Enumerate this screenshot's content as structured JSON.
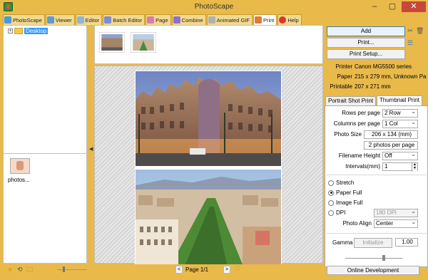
{
  "window": {
    "title": "PhotoScape",
    "min": "–",
    "max": "▢",
    "close": "✕"
  },
  "tabs": [
    {
      "label": "PhotoScape",
      "icon": "photoscape-icon",
      "color": "#4a9ad8"
    },
    {
      "label": "Viewer",
      "icon": "viewer-icon",
      "color": "#5b9bd5"
    },
    {
      "label": "Editor",
      "icon": "editor-icon",
      "color": "#8fb4d9"
    },
    {
      "label": "Batch Editor",
      "icon": "batch-editor-icon",
      "color": "#7b8bd4"
    },
    {
      "label": "Page",
      "icon": "page-icon",
      "color": "#d97ab2"
    },
    {
      "label": "Combine",
      "icon": "combine-icon",
      "color": "#8c6fd1"
    },
    {
      "label": "Animated GIF",
      "icon": "animated-gif-icon",
      "color": "#b0b0b0"
    },
    {
      "label": "Print",
      "icon": "print-icon",
      "color": "#e07a2e",
      "active": true
    },
    {
      "label": "Help",
      "icon": "help-icon",
      "color": "#d33"
    }
  ],
  "tree": {
    "expander": "+",
    "root": "Desktop"
  },
  "left": {
    "file_label": "photos...",
    "icons": [
      "★",
      "⟲",
      "🗀"
    ]
  },
  "preview": {
    "page_label": "Page 1/1",
    "prev": "<",
    "next": ">",
    "fit": "⛶"
  },
  "right": {
    "add": "Add",
    "print": "Print...",
    "print_setup": "Print Setup...",
    "printer_label": "Printer",
    "printer_value": "Canon MG5500 series",
    "paper_label": "Paper",
    "paper_value": "215 x 279 mm, Unknown Pa",
    "printable_label": "Printable",
    "printable_value": "207 x 271 mm",
    "tab_portrait": "Portrait Shot Print",
    "tab_thumbnail": "Thumbnail Print",
    "rows_label": "Rows per page",
    "rows_value": "2 Row",
    "cols_label": "Columns per page",
    "cols_value": "1 Col",
    "photo_size_label": "Photo Size",
    "photo_size_value": "206 x 134 (mm)",
    "photos_per_page": "2 photos per page",
    "filename_height_label": "Filename Height",
    "filename_height_value": "Off",
    "intervals_label": "Intervals(mm)",
    "intervals_value": "1",
    "stretch": "Stretch",
    "paper_full": "Paper Full",
    "image_full": "Image Full",
    "dpi": "DPI",
    "dpi_value": "180 DPI",
    "photo_align_label": "Photo Align",
    "photo_align_value": "Center",
    "gamma_label": "Gamma",
    "initialize": "Initialize",
    "gamma_value": "1.00",
    "online_development": "Online Development",
    "selected_fit": "paper_full"
  },
  "colors": {
    "frame": "#e9b949",
    "selection": "#3399ff",
    "close": "#c7473a"
  }
}
